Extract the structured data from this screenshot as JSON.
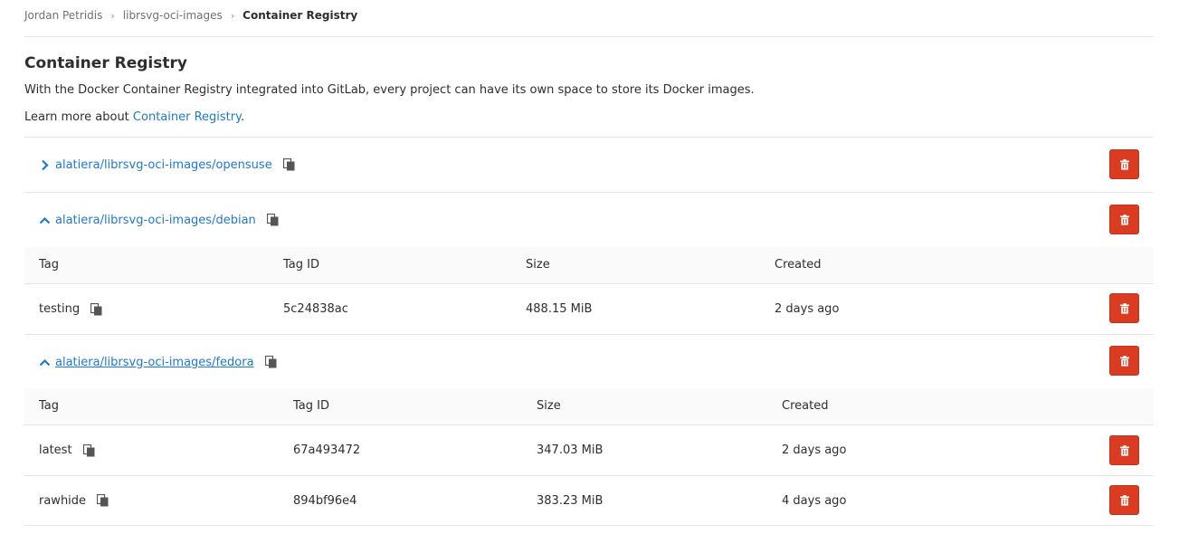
{
  "breadcrumb": {
    "items": [
      "Jordan Petridis",
      "librsvg-oci-images"
    ],
    "current": "Container Registry"
  },
  "page": {
    "title": "Container Registry",
    "intro": "With the Docker Container Registry integrated into GitLab, every project can have its own space to store its Docker images.",
    "learn_prefix": "Learn more about ",
    "learn_link": "Container Registry",
    "learn_suffix": "."
  },
  "colors": {
    "link": "#1f78d1",
    "danger": "#db3b21",
    "border": "#e5e5e5",
    "header_bg": "#fafafa"
  },
  "table_headers": {
    "tag": "Tag",
    "tag_id": "Tag ID",
    "size": "Size",
    "created": "Created"
  },
  "repositories": [
    {
      "name": "alatiera/librsvg-oci-images/opensuse",
      "expanded": false,
      "icon": "chevron-right-icon",
      "tags": []
    },
    {
      "name": "alatiera/librsvg-oci-images/debian",
      "expanded": true,
      "icon": "chevron-up-icon",
      "tags": [
        {
          "tag": "testing",
          "tag_id": "5c24838ac",
          "size": "488.15 MiB",
          "created": "2 days ago"
        }
      ]
    },
    {
      "name": "alatiera/librsvg-oci-images/fedora",
      "expanded": true,
      "icon": "chevron-up-icon",
      "tags": [
        {
          "tag": "latest",
          "tag_id": "67a493472",
          "size": "347.03 MiB",
          "created": "2 days ago"
        },
        {
          "tag": "rawhide",
          "tag_id": "894bf96e4",
          "size": "383.23 MiB",
          "created": "4 days ago"
        }
      ]
    }
  ]
}
